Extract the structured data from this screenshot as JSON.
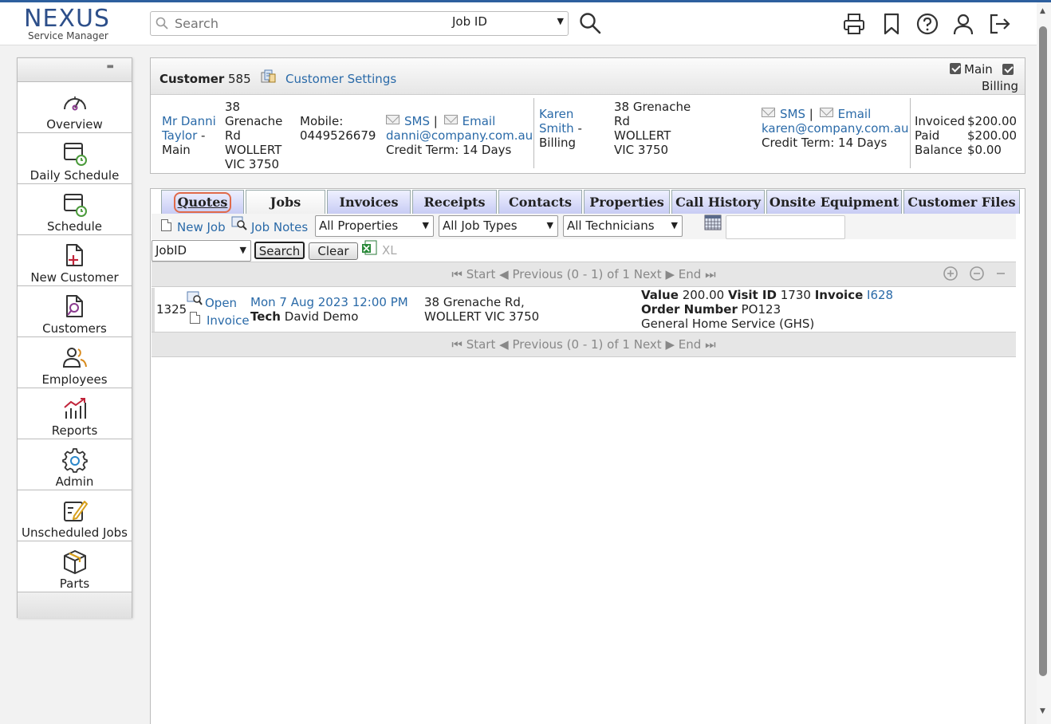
{
  "app": {
    "logo_main": "NEXUS",
    "logo_sub": "Service Manager"
  },
  "search": {
    "placeholder": "Search",
    "field_selected": "Job ID"
  },
  "sidebar": {
    "items": [
      {
        "label": "Overview",
        "icon": "gauge-icon"
      },
      {
        "label": "Daily Schedule",
        "icon": "calendar-clock-icon"
      },
      {
        "label": "Schedule",
        "icon": "calendar-clock-icon"
      },
      {
        "label": "New Customer",
        "icon": "new-document-icon"
      },
      {
        "label": "Customers",
        "icon": "document-search-icon"
      },
      {
        "label": "Employees",
        "icon": "users-icon"
      },
      {
        "label": "Reports",
        "icon": "chart-icon"
      },
      {
        "label": "Admin",
        "icon": "gear-icon"
      },
      {
        "label": "Unscheduled Jobs",
        "icon": "edit-form-icon"
      },
      {
        "label": "Parts",
        "icon": "box-icon"
      }
    ]
  },
  "customer": {
    "title": "Customer",
    "number": "585",
    "settings_link": "Customer Settings",
    "main_label": "Main",
    "billing_label": "Billing",
    "main_contact": {
      "name_line1": "Mr Danni",
      "name_line2": "Taylor",
      "name_suffix": " -",
      "role": "Main",
      "addr1": "38",
      "addr2": "Grenache",
      "addr3": "Rd",
      "addr4": "WOLLERT",
      "addr5": "VIC 3750",
      "mobile_label": "Mobile:",
      "mobile": "0449526679",
      "sms": "SMS",
      "sep": "|",
      "email_label": "Email",
      "email": "danni@company.com.au",
      "credit": "Credit Term: 14 Days"
    },
    "billing_contact": {
      "name_line1": "Karen",
      "name_line2": "Smith",
      "name_suffix": " -",
      "role": "Billing",
      "addr1": "38 Grenache",
      "addr2": "Rd",
      "addr3": "WOLLERT",
      "addr4": "VIC 3750",
      "sms": "SMS",
      "sep": "|",
      "email_label": "Email",
      "email": "karen@company.com.au",
      "credit": "Credit Term: 14 Days"
    },
    "totals": {
      "invoiced_label": "Invoiced",
      "invoiced": "$200.00",
      "paid_label": "Paid",
      "paid": "$200.00",
      "balance_label": "Balance",
      "balance": "$0.00"
    }
  },
  "tabs": [
    "Quotes",
    "Jobs",
    "Invoices",
    "Receipts",
    "Contacts",
    "Properties",
    "Call History",
    "Onsite Equipment",
    "Customer Files"
  ],
  "active_tab": "Jobs",
  "toolbar": {
    "new_job": "New Job",
    "job_notes": "Job Notes",
    "properties_filter": "All Properties",
    "job_types_filter": "All Job Types",
    "technicians_filter": "All Technicians",
    "date_value": "",
    "sort_field": "JobID",
    "search_button": "Search",
    "clear_button": "Clear",
    "export_label": "XL"
  },
  "pager": {
    "start": "Start",
    "previous": "Previous",
    "range": "(0 - 1) of 1",
    "next": "Next",
    "end": "End"
  },
  "jobs": [
    {
      "id": "1325",
      "open_link": "Open",
      "invoice_link": "Invoice",
      "datetime": "Mon 7 Aug 2023 12:00 PM",
      "tech_label": "Tech",
      "tech": "David Demo",
      "address1": "38 Grenache Rd,",
      "address2": "WOLLERT VIC 3750",
      "value_label": "Value",
      "value": "200.00",
      "visit_label": "Visit ID",
      "visit_id": "1730",
      "invoice_label": "Invoice",
      "invoice_no": "I628",
      "order_label": "Order Number",
      "order_no": "PO123",
      "job_type": "General Home Service (GHS)"
    }
  ],
  "colors": {
    "accent": "#2d5f9e",
    "link": "#2a6aa8",
    "tab_bg": "#c8ccf4",
    "highlight": "#e06a4a"
  }
}
